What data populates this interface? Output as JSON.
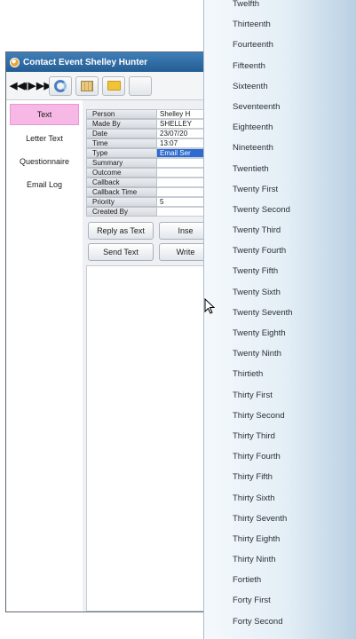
{
  "window": {
    "title": "Contact Event Shelley Hunter"
  },
  "toolbar": {
    "nav": [
      "◀◀",
      "◀",
      "▶",
      "▶▶"
    ]
  },
  "sidebar": {
    "tabs": [
      {
        "label": "Text",
        "active": true
      },
      {
        "label": "Letter Text",
        "active": false
      },
      {
        "label": "Questionnaire",
        "active": false
      },
      {
        "label": "Email Log",
        "active": false
      }
    ]
  },
  "form": {
    "fields": [
      {
        "label": "Person",
        "value": "Shelley H"
      },
      {
        "label": "Made By",
        "value": "SHELLEY"
      },
      {
        "label": "Date",
        "value": "23/07/20"
      },
      {
        "label": "Time",
        "value": "13:07"
      },
      {
        "label": "Type",
        "value": "Email Ser",
        "selected": true
      },
      {
        "label": "Summary",
        "value": ""
      },
      {
        "label": "Outcome",
        "value": ""
      },
      {
        "label": "Callback",
        "value": ""
      },
      {
        "label": "Callback Time",
        "value": ""
      },
      {
        "label": "Priority",
        "value": "5"
      },
      {
        "label": "Created By",
        "value": ""
      }
    ],
    "buttons": {
      "reply_as_text": "Reply as Text",
      "insert": "Inse",
      "send_text": "Send Text",
      "write": "Write"
    }
  },
  "dropdown": {
    "options": [
      "Twelfth",
      "Thirteenth",
      "Fourteenth",
      "Fifteenth",
      "Sixteenth",
      "Seventeenth",
      "Eighteenth",
      "Nineteenth",
      "Twentieth",
      "Twenty First",
      "Twenty Second",
      "Twenty Third",
      "Twenty Fourth",
      "Twenty Fifth",
      "Twenty Sixth",
      "Twenty Seventh",
      "Twenty Eighth",
      "Twenty Ninth",
      "Thirtieth",
      "Thirty First",
      "Thirty Second",
      "Thirty Third",
      "Thirty Fourth",
      "Thirty Fifth",
      "Thirty Sixth",
      "Thirty Seventh",
      "Thirty Eighth",
      "Thirty Ninth",
      "Fortieth",
      "Forty First",
      "Forty Second"
    ]
  },
  "colors": {
    "title_bar": "#245d94",
    "active_tab": "#f7b8e6",
    "selected_field": "#2d6bd0"
  },
  "icons": [
    "first-record-icon",
    "previous-record-icon",
    "next-record-icon",
    "last-record-icon",
    "refresh-icon",
    "grid-icon",
    "folder-icon",
    "mouse-pointer-icon"
  ]
}
